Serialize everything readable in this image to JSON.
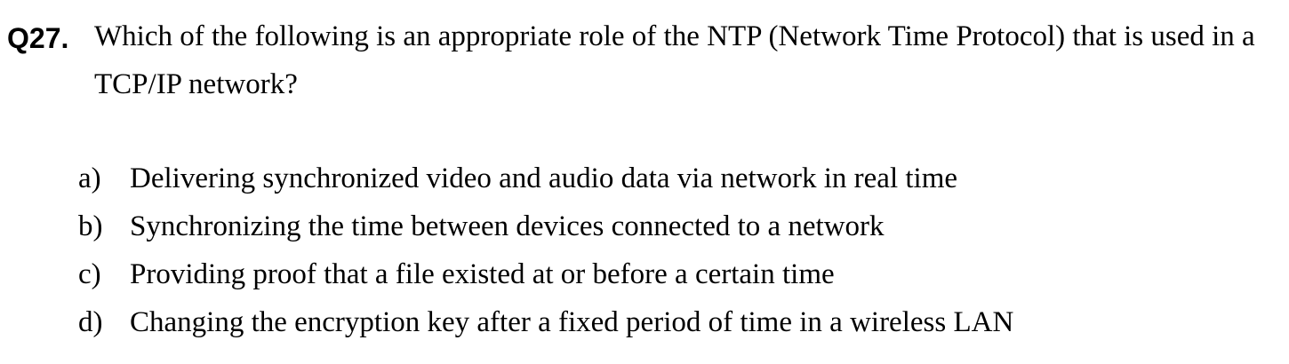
{
  "question": {
    "number": "Q27.",
    "text": "Which of the following is an appropriate role of the NTP (Network Time Protocol) that is used in a TCP/IP network?"
  },
  "choices": [
    {
      "letter": "a)",
      "text": "Delivering synchronized video and audio data via network in real time"
    },
    {
      "letter": "b)",
      "text": "Synchronizing the time between devices connected to a network"
    },
    {
      "letter": "c)",
      "text": "Providing proof that a file existed at or before a certain time"
    },
    {
      "letter": "d)",
      "text": "Changing the encryption key after a fixed period of time in a wireless LAN"
    }
  ]
}
